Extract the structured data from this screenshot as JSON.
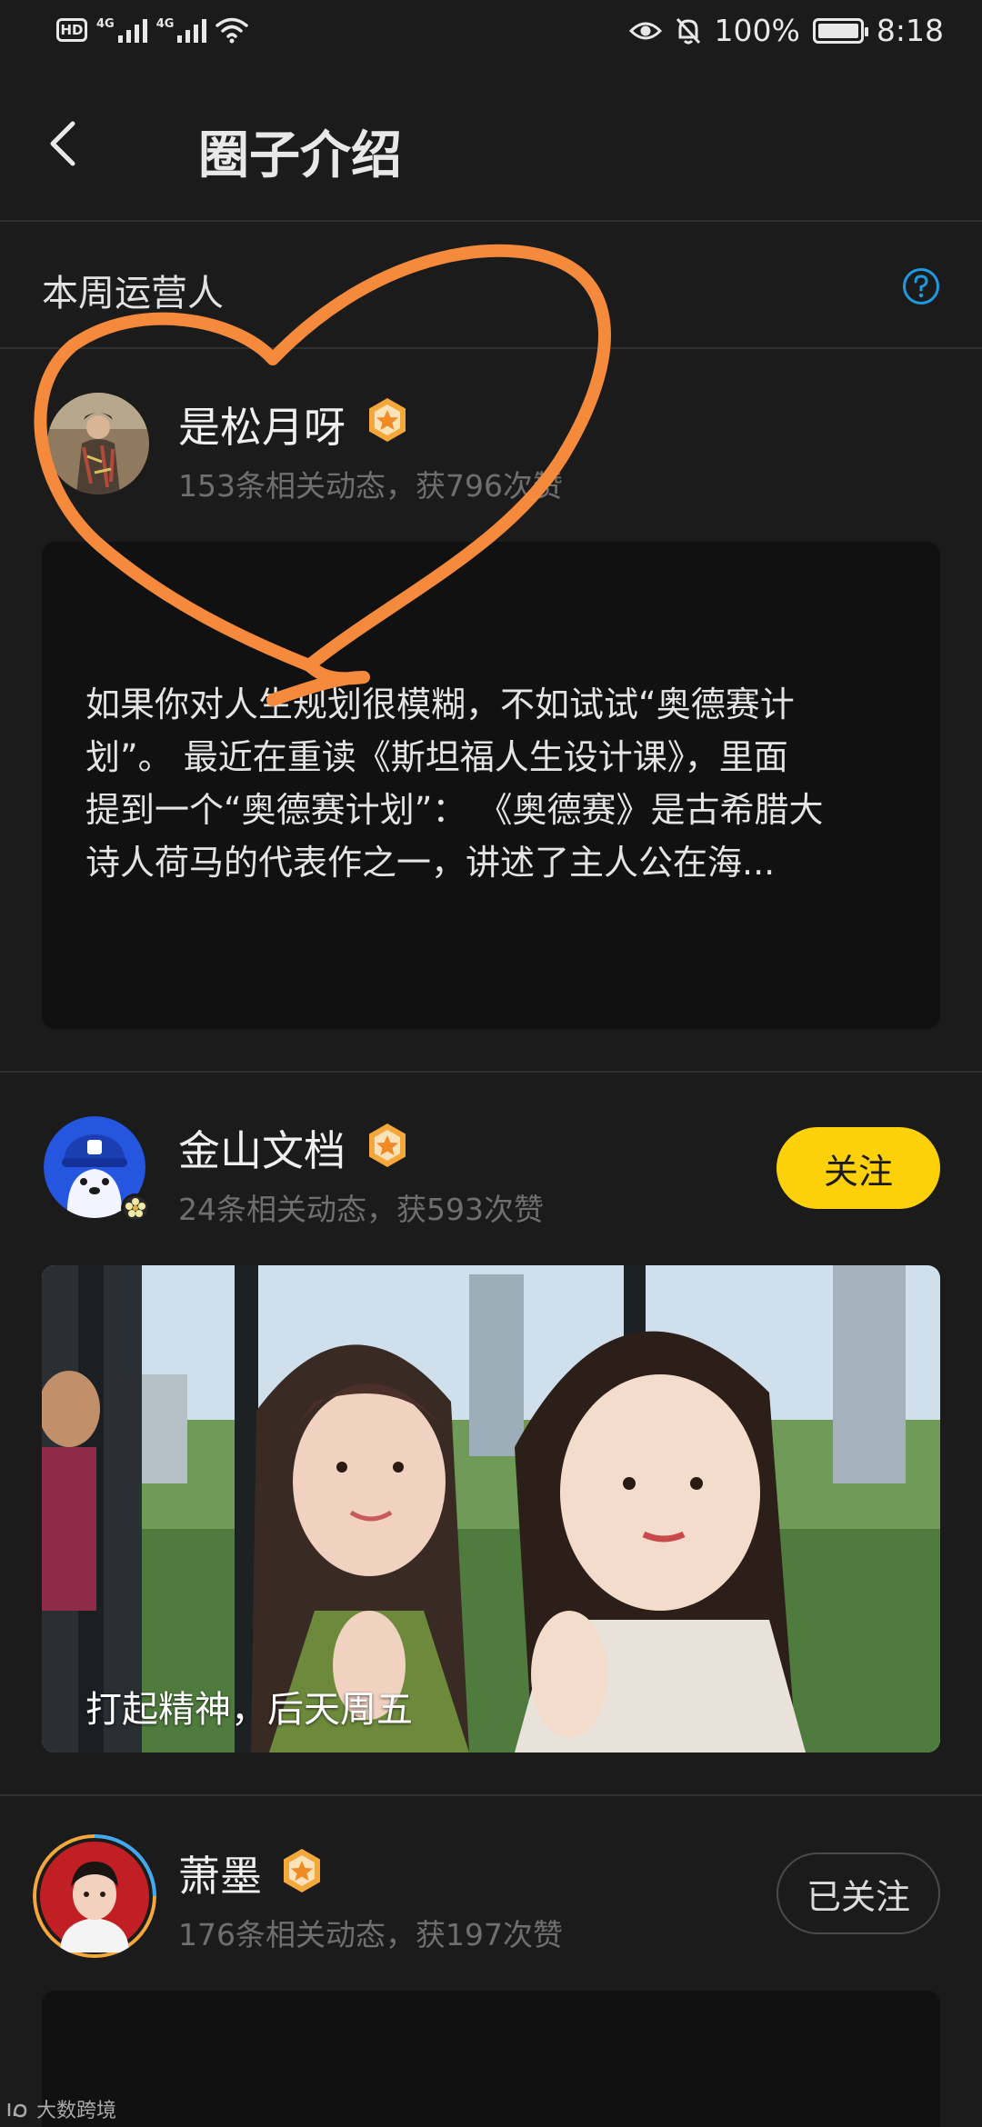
{
  "status_bar": {
    "hd": "HD",
    "net1": "4G",
    "net2": "4G",
    "battery_percent": "100%",
    "battery_level": 1.0,
    "time": "8:18"
  },
  "header": {
    "title": "圈子介绍",
    "back_icon": "chevron-left-icon"
  },
  "section": {
    "title": "本周运营人",
    "help_icon": "question-circle-icon"
  },
  "users": [
    {
      "name": "是松月呀",
      "meta": "153条相关动态，获796次赞",
      "post_lines": [
        "如果你对人生规划很模糊，不如试试“奥德赛计",
        "划”。 最近在重读《斯坦福人生设计课》，里面",
        "提到一个“奥德赛计划”：  《奥德赛》是古希腊大",
        "诗人荷马的代表作之一，讲述了主人公在海..."
      ]
    },
    {
      "name": "金山文档",
      "meta": "24条相关动态，获593次赞",
      "follow_label": "关注",
      "photo_caption": "打起精神，后天周五"
    },
    {
      "name": "萧墨",
      "meta": "176条相关动态，获197次赞",
      "follow_label": "已关注"
    }
  ],
  "watermark": "大数跨境",
  "colors": {
    "background": "#1b1b1b",
    "card": "#111111",
    "accent_yellow": "#fdd10a",
    "help_blue": "#1e9be0",
    "heart_orange": "#f58a3c",
    "badge_orange": "#f4a73a"
  }
}
